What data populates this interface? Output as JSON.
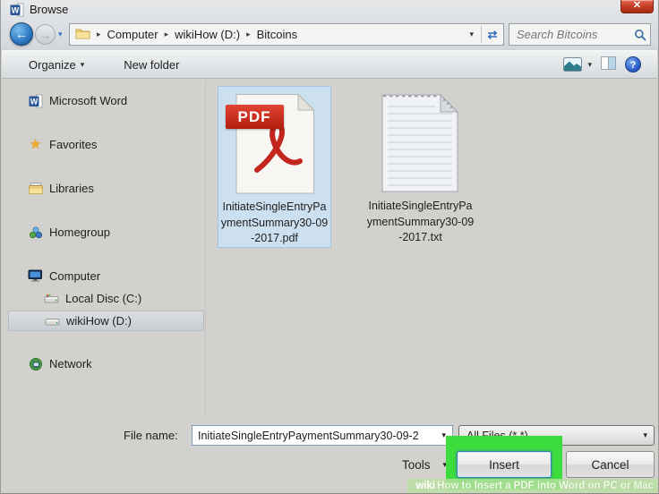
{
  "window": {
    "title": "Browse"
  },
  "glyphs": {
    "close": "✕",
    "back": "←",
    "forward": "→",
    "caret_down": "▾",
    "crumb_sep": "▸",
    "refresh": "⇄",
    "star": "★",
    "help": "?"
  },
  "address_bar": {
    "breadcrumbs": [
      {
        "label": "Computer"
      },
      {
        "label": "wikiHow (D:)"
      },
      {
        "label": "Bitcoins"
      }
    ]
  },
  "search": {
    "placeholder": "Search Bitcoins"
  },
  "toolbar": {
    "organize_label": "Organize",
    "new_folder_label": "New folder"
  },
  "sidebar": {
    "items": [
      {
        "label": "Microsoft Word"
      },
      {
        "label": "Favorites"
      },
      {
        "label": "Libraries"
      },
      {
        "label": "Homegroup"
      },
      {
        "label": "Computer"
      },
      {
        "label": "Local Disc (C:)"
      },
      {
        "label": "wikiHow (D:)"
      },
      {
        "label": "Network"
      }
    ]
  },
  "files": [
    {
      "name": "InitiateSingleEntryPaymentSummary30-09-2017.pdf",
      "type": "pdf",
      "selected": true,
      "badge": "PDF"
    },
    {
      "name": "InitiateSingleEntryPaymentSummary30-09-2017.txt",
      "type": "txt",
      "selected": false
    }
  ],
  "footer": {
    "file_name_label": "File name:",
    "file_name_value": "InitiateSingleEntryPaymentSummary30-09-2",
    "file_type_value": "All Files (*.*)",
    "tools_label": "Tools",
    "insert_label": "Insert",
    "cancel_label": "Cancel"
  },
  "watermark": {
    "wiki": "wiki",
    "rest": "How to Insert a PDF into Word on PC or Mac"
  },
  "colors": {
    "highlight_green": "#3bdc3b",
    "selection_blue": "#cde0f0",
    "pdf_red": "#c42a1a",
    "close_red": "#c23a22"
  }
}
